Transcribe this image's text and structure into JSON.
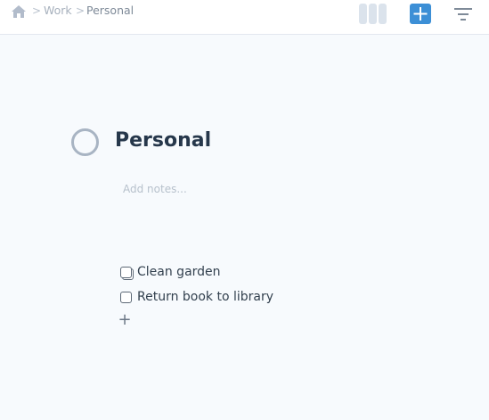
{
  "breadcrumb": {
    "home_icon": "home-icon",
    "separator": ">",
    "items": [
      {
        "label": "Work"
      },
      {
        "label": "Personal"
      }
    ]
  },
  "toolbar": {
    "board_view_icon": "columns-icon",
    "add_icon": "plus-icon",
    "filter_icon": "filter-icon"
  },
  "project": {
    "title": "Personal",
    "notes_placeholder": "Add notes..."
  },
  "tasks": [
    {
      "label": "Clean garden",
      "completed": false
    },
    {
      "label": "Return book to library",
      "completed": false
    }
  ],
  "add_task_label": "+",
  "colors": {
    "accent": "#3c8fd6",
    "background": "#f7fafd",
    "title": "#26374b"
  }
}
